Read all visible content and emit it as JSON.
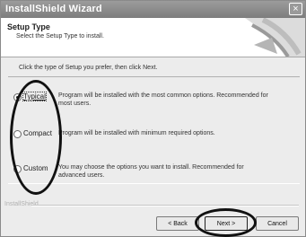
{
  "window": {
    "title": "InstallShield Wizard",
    "close_symbol": "×"
  },
  "header": {
    "title": "Setup Type",
    "subtitle": "Select the Setup Type to install."
  },
  "instruction": "Click the type of Setup you prefer, then click Next.",
  "options": [
    {
      "label": "Typical",
      "selected": true,
      "description": "Program will be installed with the most common options.  Recommended for most users."
    },
    {
      "label": "Compact",
      "selected": false,
      "description": "Program will be installed with minimum required options."
    },
    {
      "label": "Custom",
      "selected": false,
      "description": "You may choose the options you want to install. Recommended for advanced users."
    }
  ],
  "footer": {
    "brand": "InstallShield"
  },
  "buttons": {
    "back": "< Back",
    "next": "Next >",
    "cancel": "Cancel"
  }
}
